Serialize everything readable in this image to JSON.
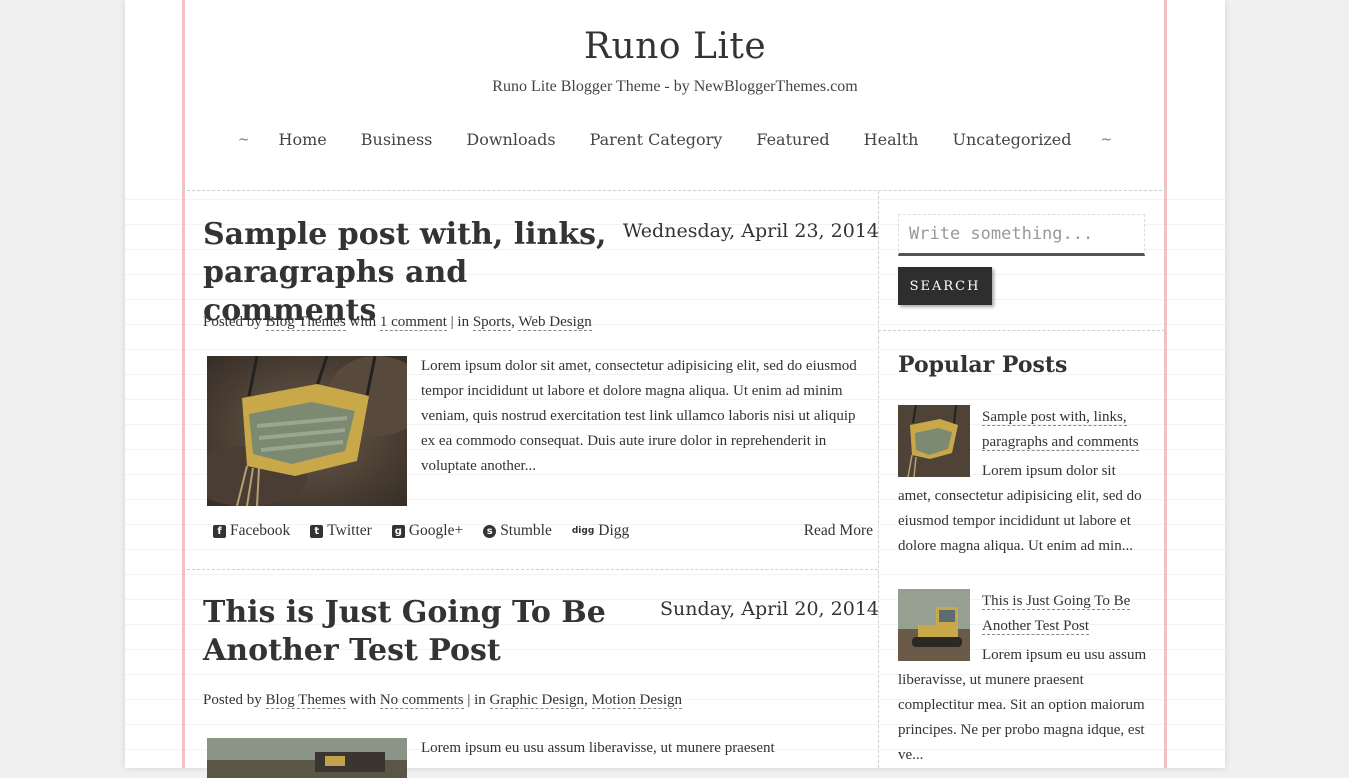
{
  "site": {
    "title": "Runo Lite",
    "description": "Runo Lite Blogger Theme - by NewBloggerThemes.com"
  },
  "nav": {
    "tilde": "~",
    "items": [
      "Home",
      "Business",
      "Downloads",
      "Parent Category",
      "Featured",
      "Health",
      "Uncategorized"
    ]
  },
  "posts": [
    {
      "title": "Sample post with, links, paragraphs and comments",
      "date": "Wednesday, April 23, 2014",
      "meta": {
        "posted_by": "Posted by",
        "author": "Blog Themes",
        "with": "with",
        "comments": "1 comment",
        "in": "| in",
        "categories": [
          "Sports",
          "Web Design"
        ]
      },
      "excerpt": "Lorem ipsum dolor sit amet, consectetur adipisicing elit, sed do eiusmod tempor incididunt ut labore et dolore magna aliqua. Ut enim ad minim veniam, quis nostrud exercitation test link ullamco laboris nisi ut aliquip ex ea commodo consequat. Duis aute irure dolor in reprehenderit in voluptate another...",
      "read_more": "Read More"
    },
    {
      "title": "This is Just Going To Be Another Test Post",
      "date": "Sunday, April 20, 2014",
      "meta": {
        "posted_by": "Posted by",
        "author": "Blog Themes",
        "with": "with",
        "comments": "No comments",
        "in": "| in",
        "categories": [
          "Graphic Design",
          "Motion Design"
        ]
      },
      "excerpt": "Lorem ipsum eu usu assum liberavisse, ut munere praesent"
    }
  ],
  "share": {
    "facebook": "Facebook",
    "twitter": "Twitter",
    "googleplus": "Google+",
    "stumble": "Stumble",
    "digg": "Digg",
    "digg_icon": "digg"
  },
  "sidebar": {
    "search_placeholder": "Write something...",
    "search_button": "SEARCH",
    "popular_title": "Popular Posts",
    "popular": [
      {
        "title": "Sample post with, links, paragraphs and comments",
        "excerpt": "Lorem ipsum dolor sit amet, consectetur adipisicing elit, sed do eiusmod tempor incididunt ut labore et dolore magna aliqua. Ut enim ad min..."
      },
      {
        "title": "This is Just Going To Be Another Test Post",
        "excerpt": "Lorem ipsum eu usu assum liberavisse, ut munere praesent complectitur mea. Sit an option maiorum principes. Ne per probo magna idque, est ve..."
      }
    ]
  },
  "colors": {
    "accent_line": "#f3c1c1",
    "button_bg": "#2e2e2e",
    "text": "#333333"
  }
}
